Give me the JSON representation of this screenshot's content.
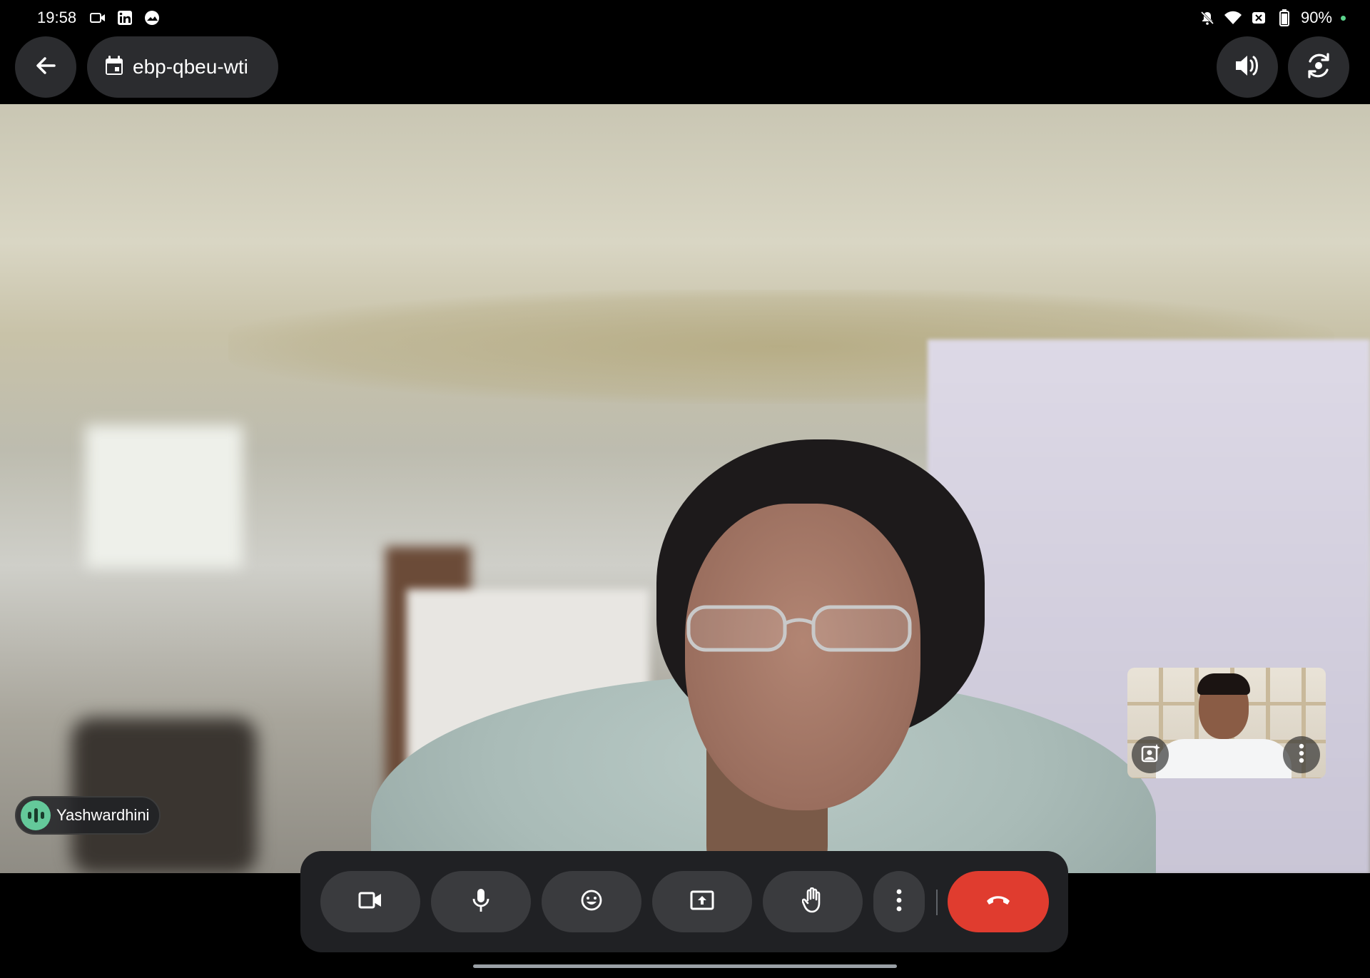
{
  "status_bar": {
    "time": "19:58",
    "left_icons": [
      "video-recording-icon",
      "linkedin-icon",
      "gallery-icon"
    ],
    "right_icons": [
      "notifications-muted-icon",
      "wifi-icon",
      "no-sim-icon",
      "battery-icon"
    ],
    "battery": "90%"
  },
  "top_bar": {
    "back_icon": "arrow-back-icon",
    "meeting_code": "ebp-qbeu-wti",
    "calendar_icon": "calendar-icon",
    "speaker_icon": "volume-icon",
    "flip_camera_icon": "flip-camera-icon"
  },
  "main_participant": {
    "name": "Yashwardhini",
    "speaking": true
  },
  "self_view": {
    "effects_icon": "image-effects-icon",
    "more_icon": "more-vert-icon"
  },
  "controls": [
    {
      "name": "camera",
      "icon": "videocam-icon"
    },
    {
      "name": "microphone",
      "icon": "mic-icon"
    },
    {
      "name": "reactions",
      "icon": "emoji-icon"
    },
    {
      "name": "present",
      "icon": "present-screen-icon"
    },
    {
      "name": "raise-hand",
      "icon": "hand-icon"
    },
    {
      "name": "more-options",
      "icon": "more-vert-icon"
    },
    {
      "name": "end-call",
      "icon": "call-end-icon"
    }
  ],
  "colors": {
    "end_call": "#e03c2f",
    "speaking_indicator": "#64c99a",
    "control_bg": "#3a3b3e",
    "bar_bg": "#202124"
  }
}
